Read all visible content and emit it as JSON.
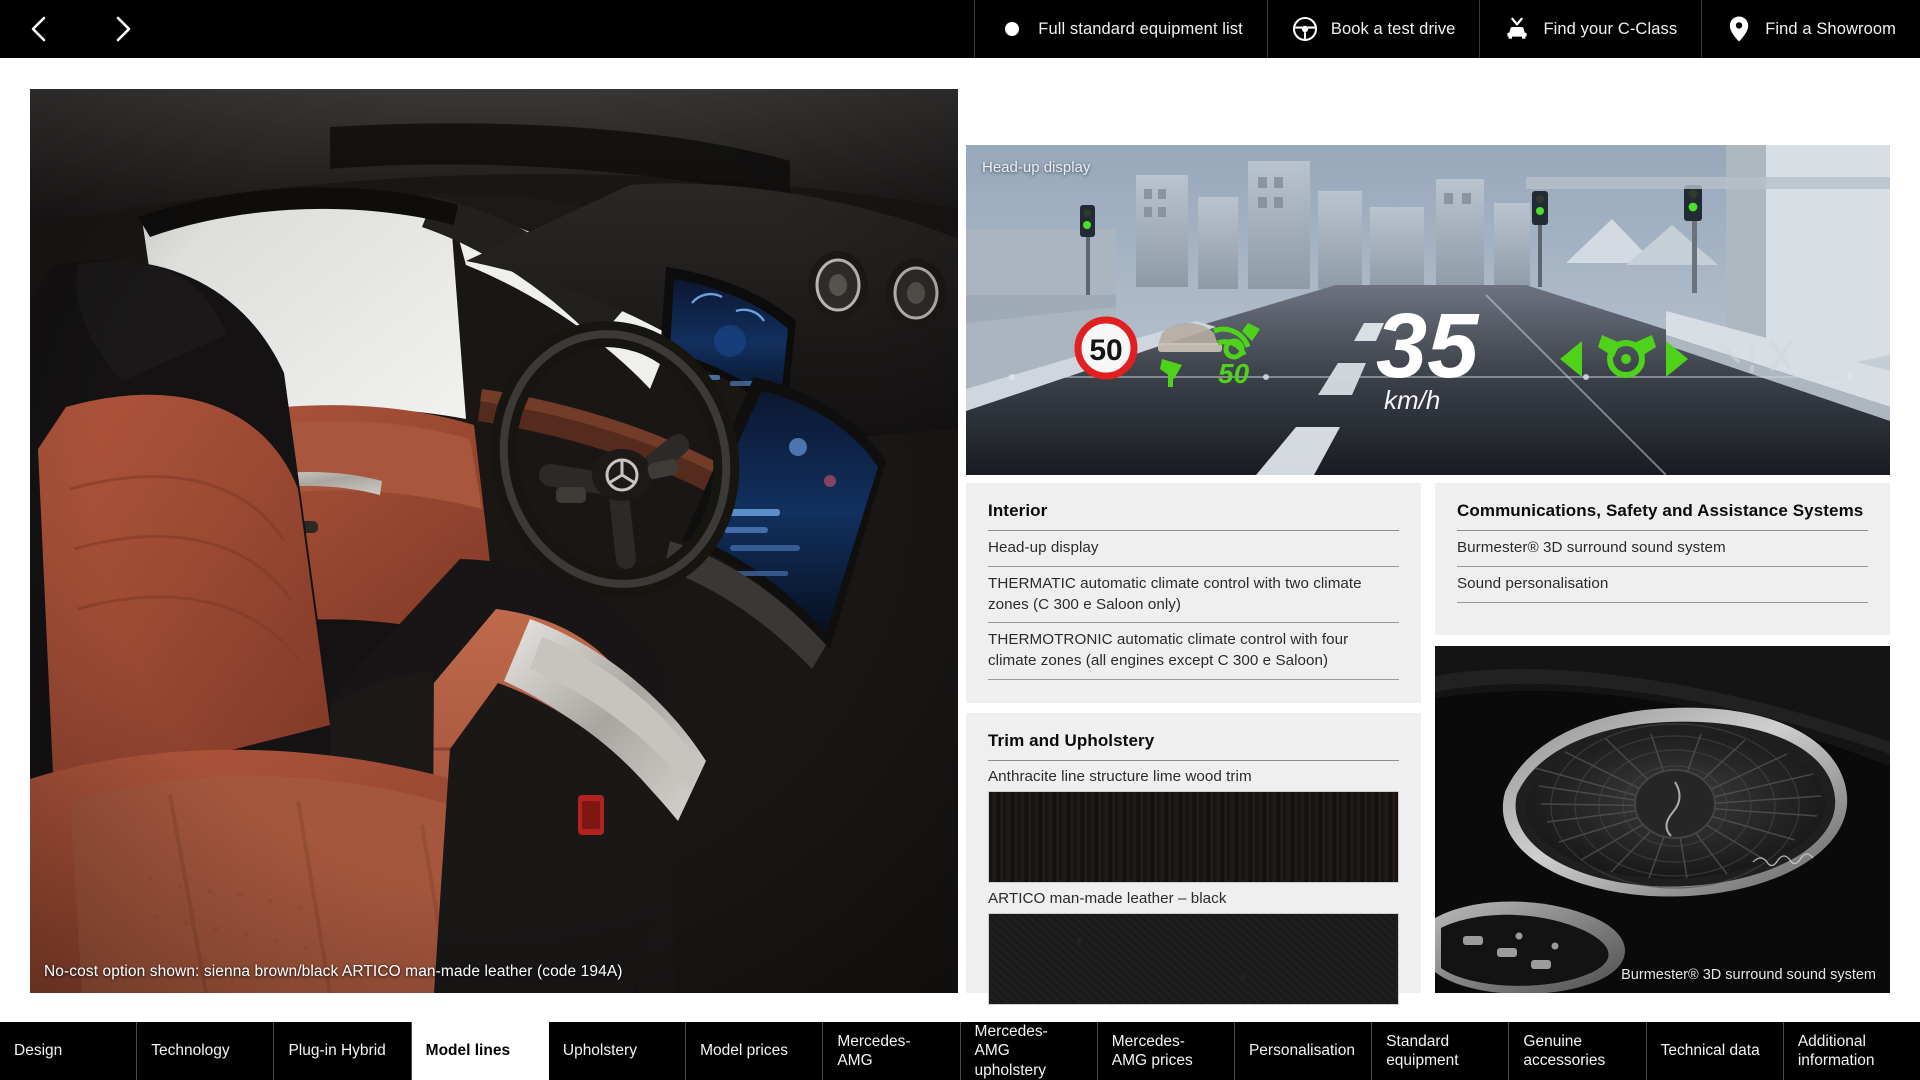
{
  "topbar": {
    "prev_label": "chevron-left",
    "next_label": "chevron-right",
    "links": [
      {
        "label": "Full standard equipment list",
        "icon": "dot-icon"
      },
      {
        "label": "Book a test drive",
        "icon": "steering-wheel-icon"
      },
      {
        "label": "Find your C-Class",
        "icon": "car-front-icon"
      },
      {
        "label": "Find a Showroom",
        "icon": "map-pin-icon"
      }
    ]
  },
  "hero": {
    "caption": "No-cost option shown: sienna brown/black ARTICO man-made leather (code 194A)",
    "alt": "Mercedes-Benz C-Class interior with sienna brown and black upholstery"
  },
  "hud": {
    "caption": "Head-up display",
    "speed_limit": "50",
    "speed_value": "35",
    "speed_unit": "km/h",
    "distance_value": "50"
  },
  "panels": {
    "interior": {
      "title": "Interior",
      "rows": [
        "Head-up display",
        "THERMATIC automatic climate control with two climate zones (C 300 e Saloon only)",
        "THERMOTRONIC automatic climate control with four climate zones (all engines except C 300 e Saloon)"
      ]
    },
    "trim": {
      "title": "Trim and Upholstery",
      "swatches": [
        {
          "label": "Anthracite line structure lime wood trim",
          "kind": "wood"
        },
        {
          "label": "ARTICO man-made leather – black",
          "kind": "leather"
        }
      ]
    },
    "comms": {
      "title": "Communications, Safety and Assistance Systems",
      "rows": [
        "Burmester® 3D surround sound system",
        "Sound personalisation"
      ]
    }
  },
  "speaker": {
    "caption": "Burmester® 3D surround sound system",
    "alt": "Burmester speaker grille in door trim"
  },
  "tabs": [
    {
      "label": "Design",
      "active": false
    },
    {
      "label": "Technology",
      "active": false
    },
    {
      "label": "Plug-in Hybrid",
      "active": false
    },
    {
      "label": "Model lines",
      "active": true
    },
    {
      "label": "Upholstery",
      "active": false
    },
    {
      "label": "Model prices",
      "active": false
    },
    {
      "label": "Mercedes-AMG",
      "active": false
    },
    {
      "label": "Mercedes-AMG upholstery",
      "active": false
    },
    {
      "label": "Mercedes-AMG prices",
      "active": false
    },
    {
      "label": "Personalisation",
      "active": false
    },
    {
      "label": "Standard equipment",
      "active": false
    },
    {
      "label": "Genuine accessories",
      "active": false
    },
    {
      "label": "Technical data",
      "active": false
    },
    {
      "label": "Additional information",
      "active": false
    }
  ],
  "colors": {
    "bar_background": "#000000",
    "panel_background": "#efefef",
    "active_tab_background": "#ffffff",
    "hud_green": "#4fd21a",
    "hud_red": "#e02020"
  }
}
